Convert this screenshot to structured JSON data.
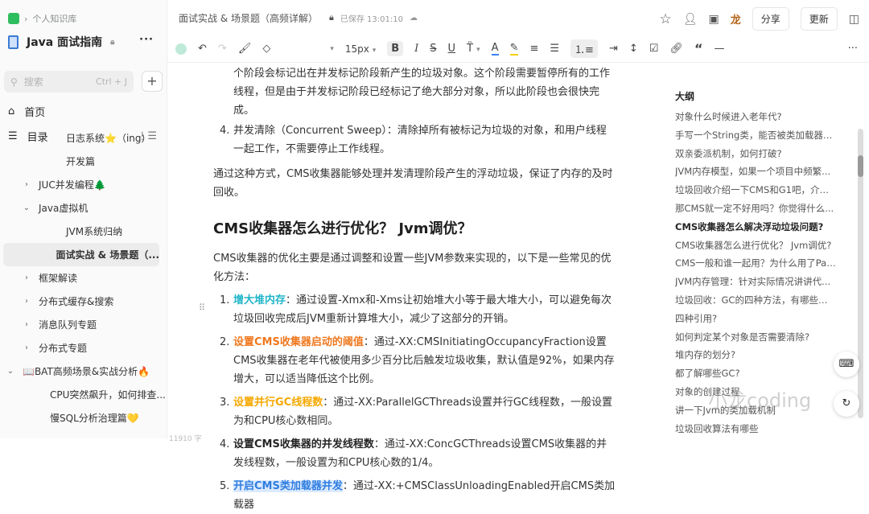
{
  "sidebar": {
    "breadcrumb": "个人知识库",
    "book_title": "Java 面试指南",
    "search_placeholder": "搜索",
    "search_shortcut": "Ctrl + J",
    "home": "首页",
    "toc": "目录",
    "tree": [
      {
        "label": "日志系统⭐（ing）",
        "indent": 2,
        "chevron": ""
      },
      {
        "label": "开发篇",
        "indent": 2,
        "chevron": ""
      },
      {
        "label": "JUC并发编程🌲",
        "indent": 1,
        "chevron": "›"
      },
      {
        "label": "Java虚拟机",
        "indent": 1,
        "chevron": "⌄"
      },
      {
        "label": "JVM系统归纳",
        "indent": 2,
        "chevron": ""
      },
      {
        "label": "面试实战 & 场景题（...",
        "indent": 2,
        "chevron": "",
        "active": true
      },
      {
        "label": "框架解读",
        "indent": 1,
        "chevron": "›"
      },
      {
        "label": "分布式缓存&搜索",
        "indent": 1,
        "chevron": "›"
      },
      {
        "label": "消息队列专题",
        "indent": 1,
        "chevron": "›"
      },
      {
        "label": "分布式专题",
        "indent": 1,
        "chevron": "›"
      },
      {
        "label": "📖BAT高频场景&实战分析🔥",
        "indent": 0,
        "chevron": "⌄"
      },
      {
        "label": "CPU突然飙升，如何排查...",
        "indent": 1,
        "chevron": ""
      },
      {
        "label": "慢SQL分析治理篇💛",
        "indent": 1,
        "chevron": ""
      }
    ]
  },
  "header": {
    "doc_title": "面试实战 & 场景题（高频详解）",
    "saved": "已保存 13:01:10",
    "share": "分享",
    "update": "更新"
  },
  "toolbar": {
    "font_size": "15px"
  },
  "content": {
    "p1": "个阶段会标记出在并发标记阶段新产生的垃圾对象。这个阶段需要暂停所有的工作线程，但是由于并发标记阶段已经标记了绝大部分对象，所以此阶段也会很快完成。",
    "item4_num": "4.",
    "item4": "并发清除（Concurrent Sweep）：清除掉所有被标记为垃圾的对象，和用户线程一起工作，不需要停止工作线程。",
    "p2": "通过这种方式，CMS收集器能够处理并发清理阶段产生的浮动垃圾，保证了内存的及时回收。",
    "heading": "CMS收集器怎么进行优化？ Jvm调优？",
    "p3": "CMS收集器的优化主要是通过调整和设置一些JVM参数来实现的，以下是一些常见的优化方法：",
    "list": [
      {
        "num": "1.",
        "title": "增大堆内存",
        "color": "#1fb5c9",
        "text": "：通过设置-Xmx和-Xms让初始堆大小等于最大堆大小，可以避免每次垃圾回收完成后JVM重新计算堆大小，减少了这部分的开销。"
      },
      {
        "num": "2.",
        "title": "设置CMS收集器启动的阈值",
        "color": "#f0781e",
        "text": "：通过-XX:CMSInitiatingOccupancyFraction设置CMS收集器在老年代被使用多少百分比后触发垃圾收集，默认值是92%，如果内存增大，可以适当降低这个比例。"
      },
      {
        "num": "3.",
        "title": "设置并行GC线程数",
        "color": "#f5a800",
        "text": "：通过-XX:ParallelGCThreads设置并行GC线程数，一般设置为和CPU核心数相同。"
      },
      {
        "num": "4.",
        "title": "设置CMS收集器的并发线程数",
        "color": "#262626",
        "text": "：通过-XX:ConcGCThreads设置CMS收集器的并发线程数，一般设置为和CPU核心数的1/4。"
      },
      {
        "num": "5.",
        "title": "开启CMS类加载器并发",
        "color": "#2f7de1",
        "text": "：通过-XX:+CMSClassUnloadingEnabled开启CMS类加载器"
      }
    ],
    "word_count": "11910 字"
  },
  "outline": {
    "title": "大纲",
    "items": [
      "对象什么时候进入老年代?",
      "手写一个String类，能否被类加载器加...",
      "双亲委派机制，如何打破?",
      "JVM内存模型，如果一个项目中频繁...",
      "垃圾回收介绍一下CMS和G1吧，介绍...",
      "那CMS就一定不好用吗？你觉得什么...",
      "CMS收集器怎么解决浮动垃圾问题?",
      "CMS收集器怎么进行优化？ Jvm调优?",
      "CMS一般和谁一起用？为什么用了Par...",
      "JVM内存管理：针对实际情况讲讲代...",
      "垃圾回收：GC的四种方法，有哪些收...",
      "四种引用?",
      "如何判定某个对象是否需要清除?",
      "堆内存的划分?",
      "都了解哪些GC?",
      "对象的创建过程",
      "讲一下Jvm的类加载机制",
      "垃圾回收算法有哪些"
    ],
    "current": 6
  },
  "watermark": "小龙coding"
}
